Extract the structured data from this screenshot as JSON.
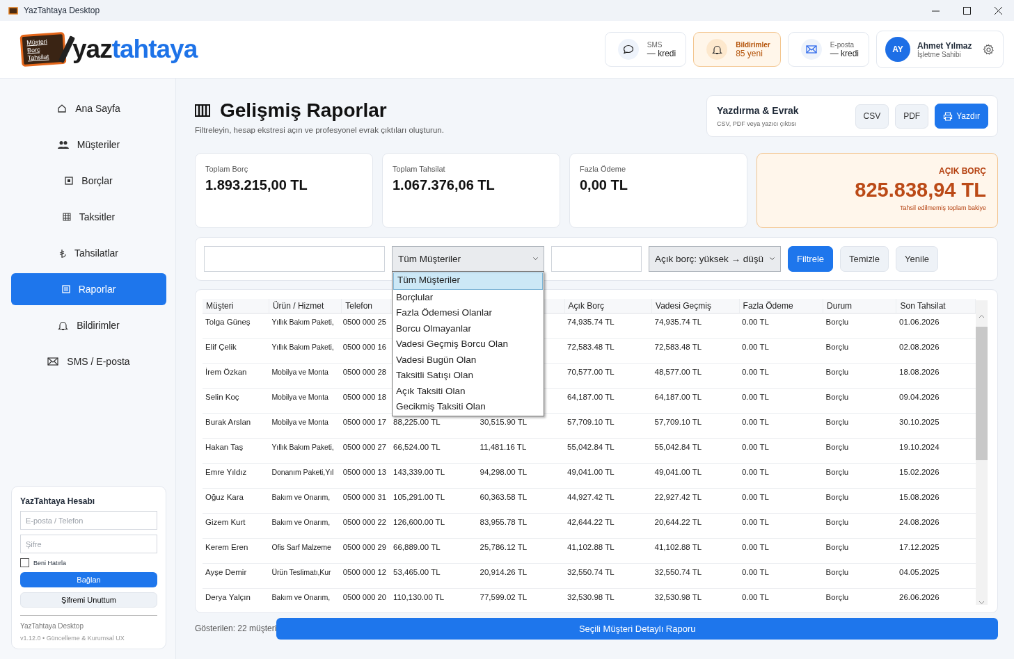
{
  "window": {
    "title": "YazTahtaya Desktop"
  },
  "header": {
    "logo": {
      "board_lines": [
        "Müşteri",
        "Borç",
        "Tahsilat"
      ],
      "word_dark": "yaz",
      "word_blue": "tahtaya"
    },
    "pills": [
      {
        "kind": "sms",
        "label": "SMS",
        "value": "— kredi",
        "highlighted": false
      },
      {
        "kind": "bell",
        "label": "Bildirimler",
        "value": "85 yeni",
        "highlighted": true
      },
      {
        "kind": "mail",
        "label": "E-posta",
        "value": "— kredi",
        "highlighted": false
      }
    ],
    "user": {
      "initials": "AY",
      "name": "Ahmet Yılmaz",
      "role": "İşletme Sahibi"
    }
  },
  "sidebar": {
    "items": [
      {
        "kind": "home",
        "label": "Ana Sayfa",
        "selected": false
      },
      {
        "kind": "people",
        "label": "Müşteriler",
        "selected": false
      },
      {
        "kind": "square",
        "label": "Borçlar",
        "selected": false
      },
      {
        "kind": "grid",
        "label": "Taksitler",
        "selected": false
      },
      {
        "kind": "lira",
        "label": "Tahsilatlar",
        "selected": false
      },
      {
        "kind": "list",
        "label": "Raporlar",
        "selected": true
      },
      {
        "kind": "bell",
        "label": "Bildirimler",
        "selected": false
      },
      {
        "kind": "mail",
        "label": "SMS / E-posta",
        "selected": false
      }
    ],
    "account": {
      "title": "YazTahtaya Hesabı",
      "email_placeholder": "E-posta / Telefon",
      "password_placeholder": "Şifre",
      "remember": {
        "label": "Beni Hatırla",
        "checked": false
      },
      "connect_button": "Bağlan",
      "forgot_button": "Şifremi Unuttum",
      "app_name": "YazTahtaya Desktop",
      "version": "v1.12.0 • Güncelleme & Kurumsal UX"
    }
  },
  "page": {
    "title": "Gelişmiş Raporlar",
    "subtitle": "Filtreleyin, hesap ekstresi açın ve profesyonel evrak çıktıları oluşturun.",
    "print_card": {
      "title": "Yazdırma & Evrak",
      "subtitle": "CSV, PDF veya yazıcı çıktısı",
      "buttons": [
        {
          "kind": "plain",
          "label": "CSV"
        },
        {
          "kind": "plain",
          "label": "PDF"
        },
        {
          "kind": "print",
          "label": "Yazdır"
        }
      ]
    },
    "stats": [
      {
        "kind": "plain",
        "label": "Toplam Borç",
        "value": "1.893.215,00 TL"
      },
      {
        "kind": "plain",
        "label": "Toplam Tahsilat",
        "value": "1.067.376,06 TL"
      },
      {
        "kind": "plain",
        "label": "Fazla Ödeme",
        "value": "0,00 TL"
      },
      {
        "kind": "highlight",
        "label": "AÇIK BORÇ",
        "value": "825.838,94 TL",
        "note": "Tahsil edilmemiş toplam bakiye"
      }
    ]
  },
  "filters": {
    "customer_filter": {
      "value": "Tüm Müşteriler",
      "expanded": true,
      "options": [
        {
          "label": "Tüm Müşteriler",
          "selected": true
        },
        {
          "label": "Borçlular",
          "selected": false
        },
        {
          "label": "Fazla Ödemesi Olanlar",
          "selected": false
        },
        {
          "label": "Borcu Olmayanlar",
          "selected": false
        },
        {
          "label": "Vadesi Geçmiş Borcu Olan",
          "selected": false
        },
        {
          "label": "Vadesi Bugün Olan",
          "selected": false
        },
        {
          "label": "Taksitli Satışı Olan",
          "selected": false
        },
        {
          "label": "Açık Taksiti Olan",
          "selected": false
        },
        {
          "label": "Gecikmiş Taksiti Olan",
          "selected": false
        }
      ]
    },
    "sort": {
      "value": "Açık borç: yüksek → düşü"
    },
    "buttons": [
      {
        "kind": "primary",
        "label": "Filtrele"
      },
      {
        "kind": "plain",
        "label": "Temizle"
      },
      {
        "kind": "plain",
        "label": "Yenile"
      }
    ]
  },
  "table": {
    "columns": [
      "Müşteri",
      "Ürün / Hizmet",
      "Telefon",
      null,
      null,
      "Açık Borç",
      "Vadesi Geçmiş",
      "Fazla Ödeme",
      "Durum",
      "Son Tahsilat"
    ],
    "rows": [
      [
        "Tolga Güneş",
        "Yıllık Bakım Paketi,",
        "0500 000 25",
        null,
        null,
        "74,935.74 TL",
        "74,935.74 TL",
        "0.00 TL",
        "Borçlu",
        "01.06.2026"
      ],
      [
        "Elif Çelik",
        "Yıllık Bakım Paketi,",
        "0500 000 16",
        null,
        null,
        "72,583.48 TL",
        "72,583.48 TL",
        "0.00 TL",
        "Borçlu",
        "02.08.2026"
      ],
      [
        "İrem Özkan",
        "Mobilya ve Monta",
        "0500 000 28",
        null,
        null,
        "70,577.00 TL",
        "48,577.00 TL",
        "0.00 TL",
        "Borçlu",
        "18.08.2026"
      ],
      [
        "Selin Koç",
        "Mobilya ve Monta",
        "0500 000 18",
        null,
        null,
        "64,187.00 TL",
        "64,187.00 TL",
        "0.00 TL",
        "Borçlu",
        "09.04.2026"
      ],
      [
        "Burak Arslan",
        "Mobilya ve Monta",
        "0500 000 17",
        "88,225.00 TL",
        "30,515.90 TL",
        "57,709.10 TL",
        "57,709.10 TL",
        "0.00 TL",
        "Borçlu",
        "30.10.2025"
      ],
      [
        "Hakan Taş",
        "Yıllık Bakım Paketi,",
        "0500 000 27",
        "66,524.00 TL",
        "11,481.16 TL",
        "55,042.84 TL",
        "55,042.84 TL",
        "0.00 TL",
        "Borçlu",
        "19.10.2024"
      ],
      [
        "Emre Yıldız",
        "Donanım Paketi,Yıl",
        "0500 000 13",
        "143,339.00 TL",
        "94,298.00 TL",
        "49,041.00 TL",
        "49,041.00 TL",
        "0.00 TL",
        "Borçlu",
        "15.02.2026"
      ],
      [
        "Oğuz Kara",
        "Bakım ve Onarım,",
        "0500 000 31",
        "105,291.00 TL",
        "60,363.58 TL",
        "44,927.42 TL",
        "22,927.42 TL",
        "0.00 TL",
        "Borçlu",
        "15.08.2026"
      ],
      [
        "Gizem Kurt",
        "Bakım ve Onarım,",
        "0500 000 22",
        "126,600.00 TL",
        "83,955.78 TL",
        "42,644.22 TL",
        "20,644.22 TL",
        "0.00 TL",
        "Borçlu",
        "24.08.2026"
      ],
      [
        "Kerem Eren",
        "Ofis Sarf Malzeme",
        "0500 000 29",
        "66,889.00 TL",
        "25,786.12 TL",
        "41,102.88 TL",
        "41,102.88 TL",
        "0.00 TL",
        "Borçlu",
        "17.12.2025"
      ],
      [
        "Ayşe Demir",
        "Ürün Teslimatı,Kur",
        "0500 000 12",
        "53,465.00 TL",
        "20,914.26 TL",
        "32,550.74 TL",
        "32,550.74 TL",
        "0.00 TL",
        "Borçlu",
        "04.05.2025"
      ],
      [
        "Derya Yalçın",
        "Bakım ve Onarım,",
        "0500 000 20",
        "110,130.00 TL",
        "77,599.02 TL",
        "32,530.98 TL",
        "32,530.98 TL",
        "0.00 TL",
        "Borçlu",
        "26.06.2026"
      ]
    ]
  },
  "footer": {
    "count": "Gösterilen: 22 müşteri",
    "report_button": "Seçili Müşteri Detaylı Raporu"
  }
}
